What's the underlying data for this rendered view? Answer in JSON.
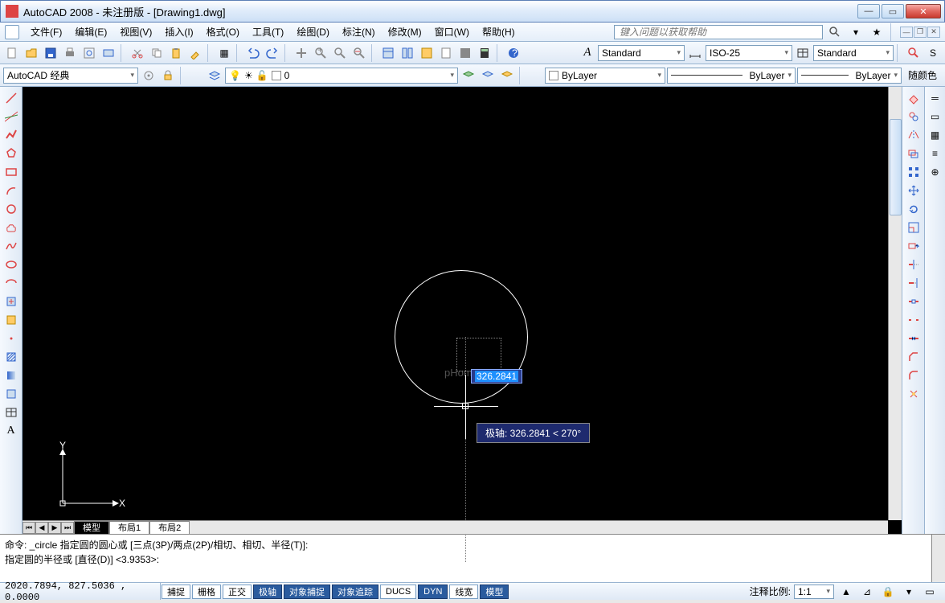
{
  "window": {
    "title": "AutoCAD 2008 - 未注册版 - [Drawing1.dwg]"
  },
  "menu": {
    "items": [
      "文件(F)",
      "编辑(E)",
      "视图(V)",
      "插入(I)",
      "格式(O)",
      "工具(T)",
      "绘图(D)",
      "标注(N)",
      "修改(M)",
      "窗口(W)",
      "帮助(H)"
    ],
    "help_placeholder": "键入问题以获取帮助"
  },
  "toolbar2": {
    "workspace": "AutoCAD 经典",
    "layer": "0",
    "text_style": "Standard",
    "dim_style": "ISO-25",
    "table_style": "Standard"
  },
  "properties": {
    "layer": "ByLayer",
    "linetype": "ByLayer",
    "lineweight": "ByLayer",
    "color_label": "随颜色"
  },
  "tabs": {
    "model": "模型",
    "layout1": "布局1",
    "layout2": "布局2"
  },
  "command": {
    "line1": "命令: _circle 指定圆的圆心或 [三点(3P)/两点(2P)/相切、相切、半径(T)]:",
    "line2": "指定圆的半径或 [直径(D)] <3.9353>:"
  },
  "dynamic": {
    "value": "326.2841",
    "polar": "极轴: 326.2841 < 270°"
  },
  "status": {
    "coords": "2020.7894, 827.5036 , 0.0000",
    "buttons": [
      "捕捉",
      "栅格",
      "正交",
      "极轴",
      "对象捕捉",
      "对象追踪",
      "DUCS",
      "DYN",
      "线宽",
      "模型"
    ],
    "pressed": [
      false,
      false,
      false,
      true,
      true,
      true,
      false,
      true,
      false,
      true
    ],
    "annoscale_label": "注释比例:",
    "annoscale": "1:1"
  },
  "ucs": {
    "x": "X",
    "y": "Y"
  }
}
